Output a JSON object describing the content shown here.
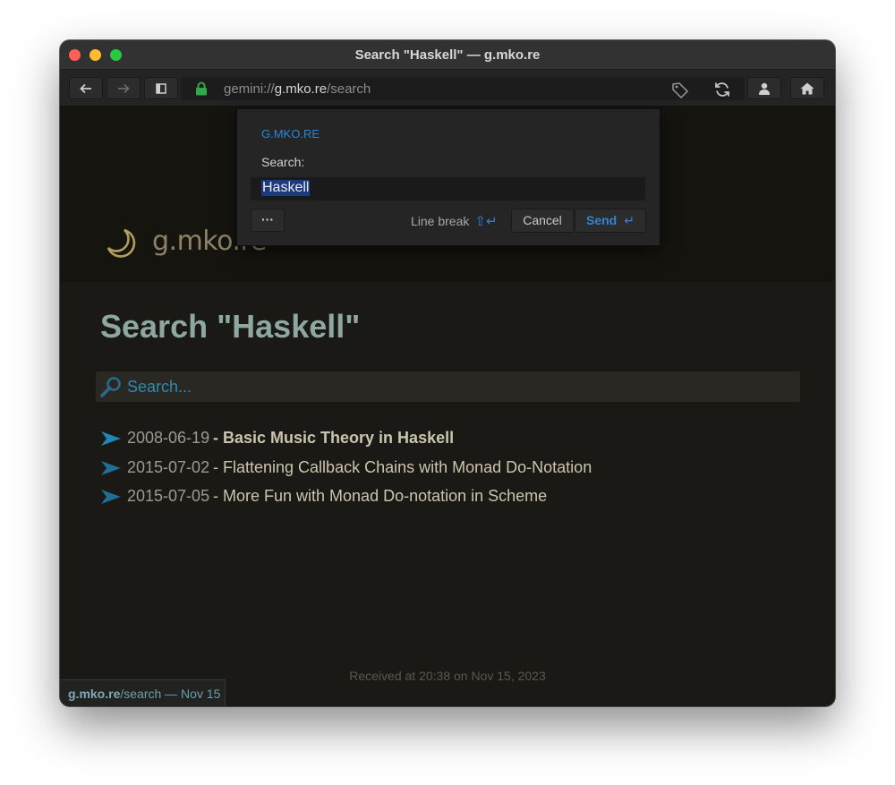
{
  "window": {
    "title": "Search \"Haskell\" — g.mko.re"
  },
  "toolbar": {
    "url_scheme": "gemini://",
    "url_host": "g.mko.re",
    "url_path": "/search"
  },
  "site": {
    "name": "g.mko.re"
  },
  "page": {
    "heading": "Search \"Haskell\"",
    "search_link_label": "Search...",
    "results": [
      {
        "date": "2008-06-19",
        "sep": " - ",
        "title": "Basic Music Theory in Haskell"
      },
      {
        "date": "2015-07-02",
        "sep": " - ",
        "title": "Flattening Callback Chains with Monad Do-Notation"
      },
      {
        "date": "2015-07-05",
        "sep": " - ",
        "title": "More Fun with Monad Do-notation in Scheme"
      }
    ],
    "received": "Received at 20:38 on Nov 15, 2023"
  },
  "status": {
    "host": "g.mko.re",
    "rest": "/search — Nov 15"
  },
  "dialog": {
    "host_label": "G.MKO.RE",
    "prompt": "Search:",
    "input_value": "Haskell",
    "more_label": "···",
    "line_break_label": "Line break",
    "line_break_icon": "⇧↵",
    "cancel_label": "Cancel",
    "send_label": "Send",
    "send_icon": "↵"
  },
  "colors": {
    "accent_blue": "#2b86d9",
    "heading": "#8ea7a0",
    "link_teal": "#2d8ab2",
    "background": "#1a1915"
  }
}
